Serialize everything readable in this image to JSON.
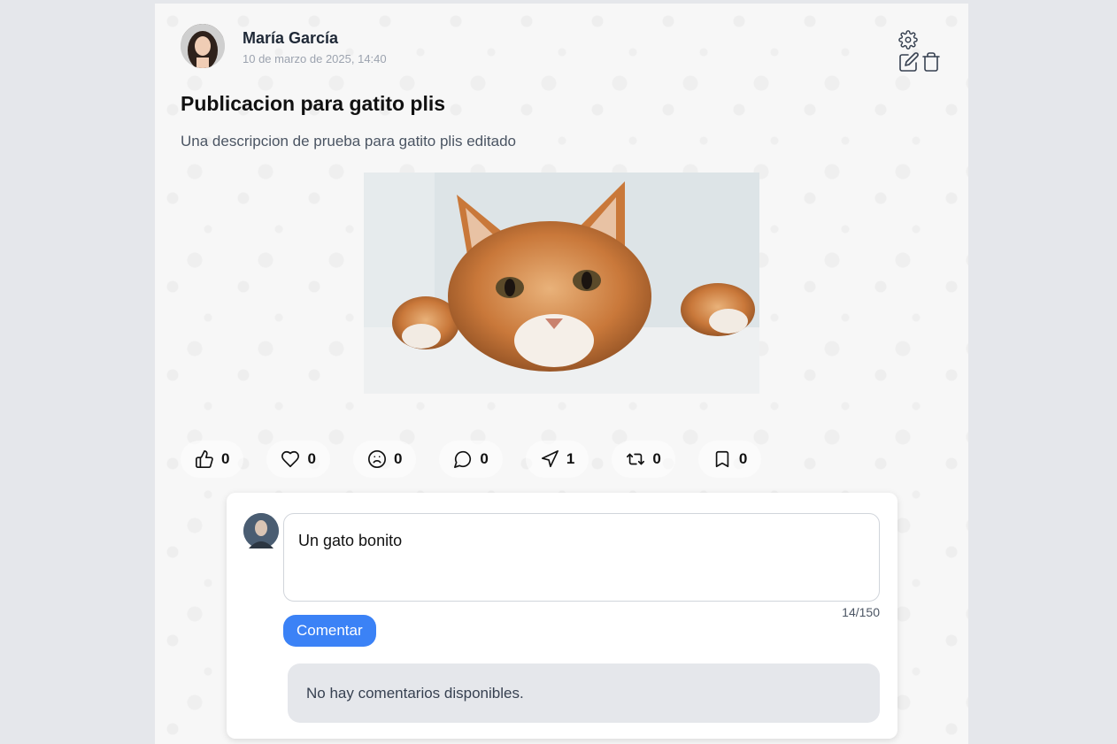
{
  "post": {
    "author_name": "María García",
    "date": "10 de marzo de 2025, 14:40",
    "title": "Publicacion para gatito plis",
    "description": "Una descripcion de prueba para gatito plis editado",
    "image_label": "cat photo"
  },
  "owner_actions": {
    "settings_icon": "gear-icon",
    "edit_icon": "edit-icon",
    "delete_icon": "trash-icon"
  },
  "reactions": [
    {
      "name": "like",
      "icon": "thumbs-up-icon",
      "count": "0"
    },
    {
      "name": "love",
      "icon": "heart-icon",
      "count": "0"
    },
    {
      "name": "sad",
      "icon": "frown-icon",
      "count": "0"
    },
    {
      "name": "comment",
      "icon": "message-circle-icon",
      "count": "0"
    },
    {
      "name": "share",
      "icon": "send-icon",
      "count": "1"
    },
    {
      "name": "repost",
      "icon": "repeat-icon",
      "count": "0"
    },
    {
      "name": "save",
      "icon": "bookmark-icon",
      "count": "0"
    }
  ],
  "comment_form": {
    "value": "Un gato bonito",
    "counter": "14/150",
    "button_label": "Comentar"
  },
  "comments": {
    "empty_message": "No hay comentarios disponibles."
  },
  "colors": {
    "page_bg": "#e5e7eb",
    "accent": "#3b82f6",
    "muted_text": "#9ca3af"
  }
}
